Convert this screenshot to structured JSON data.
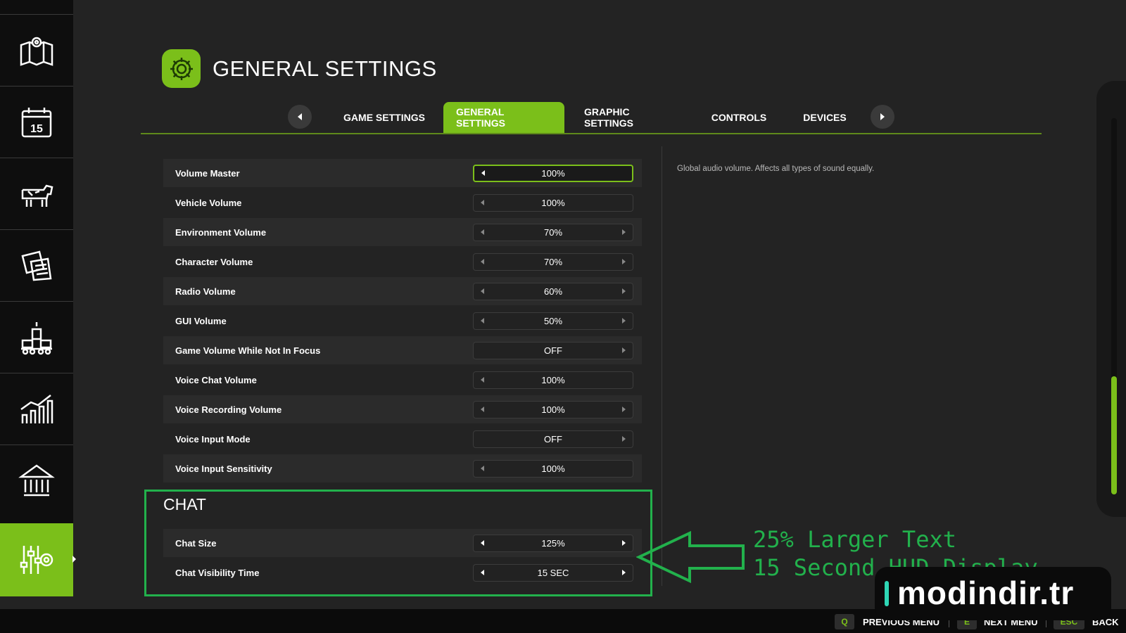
{
  "sidebar": {
    "items": [
      {
        "icon": "map-icon"
      },
      {
        "icon": "calendar-icon",
        "day": "15"
      },
      {
        "icon": "cow-icon"
      },
      {
        "icon": "contracts-icon"
      },
      {
        "icon": "production-icon"
      },
      {
        "icon": "statistics-icon"
      },
      {
        "icon": "bank-icon"
      },
      {
        "icon": "settings-sliders-icon",
        "active": true
      }
    ]
  },
  "header": {
    "title": "GENERAL SETTINGS",
    "icon": "gear-icon"
  },
  "tabs": [
    {
      "label": "GAME SETTINGS"
    },
    {
      "label": "GENERAL SETTINGS",
      "active": true
    },
    {
      "label": "GRAPHIC SETTINGS"
    },
    {
      "label": "CONTROLS"
    },
    {
      "label": "DEVICES"
    }
  ],
  "audio_settings": [
    {
      "label": "Volume Master",
      "value": "100%"
    },
    {
      "label": "Vehicle Volume",
      "value": "100%"
    },
    {
      "label": "Environment Volume",
      "value": "70%"
    },
    {
      "label": "Character Volume",
      "value": "70%"
    },
    {
      "label": "Radio Volume",
      "value": "60%"
    },
    {
      "label": "GUI Volume",
      "value": "50%"
    },
    {
      "label": "Game Volume While Not In Focus",
      "value": "OFF"
    },
    {
      "label": "Voice Chat Volume",
      "value": "100%"
    },
    {
      "label": "Voice Recording Volume",
      "value": "100%"
    },
    {
      "label": "Voice Input Mode",
      "value": "OFF"
    },
    {
      "label": "Voice Input Sensitivity",
      "value": "100%"
    }
  ],
  "chat": {
    "title": "CHAT",
    "settings": [
      {
        "label": "Chat Size",
        "value": "125%"
      },
      {
        "label": "Chat Visibility Time",
        "value": "15 SEC"
      }
    ]
  },
  "description": "Global audio volume. Affects all types of sound equally.",
  "annotation": {
    "line1": "25% Larger Text",
    "line2": "15 Second HUD Display",
    "color": "#22b14c"
  },
  "watermark": "modindir.tr",
  "footer": [
    {
      "key": "Q",
      "label": "PREVIOUS MENU"
    },
    {
      "key": "E",
      "label": "NEXT MENU"
    },
    {
      "key": "ESC",
      "label": "BACK"
    }
  ],
  "colors": {
    "accent": "#7bbf1a",
    "annotation": "#22b14c",
    "background": "#232323"
  }
}
